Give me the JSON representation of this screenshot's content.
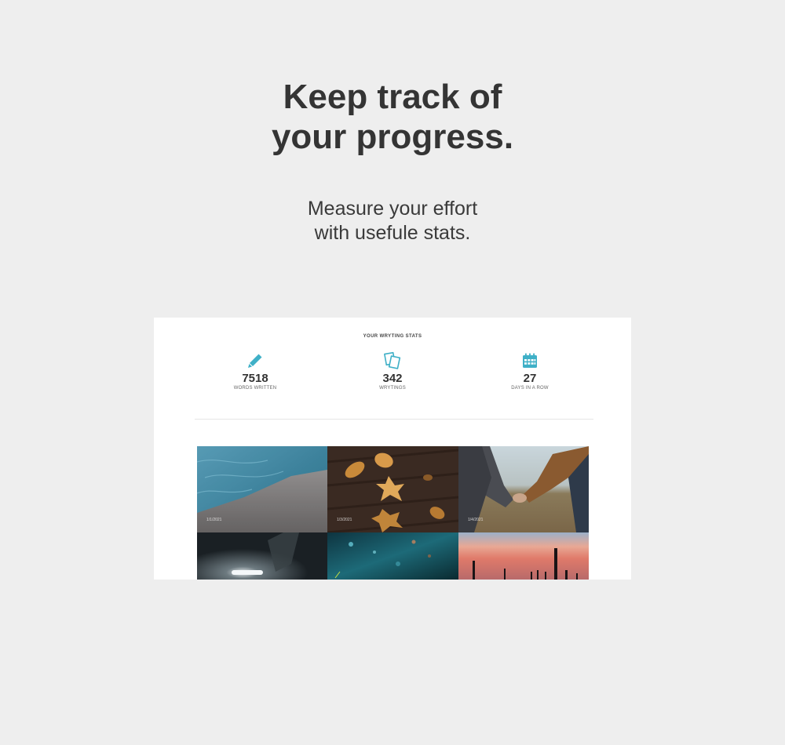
{
  "headline": {
    "line1": "Keep track of",
    "line2": "your progress."
  },
  "subhead": {
    "line1": "Measure your effort",
    "line2": "with usefule stats."
  },
  "stats": {
    "title": "YOUR WRYTING STATS",
    "accent": "#3fb0c7",
    "items": [
      {
        "icon": "pencil-icon",
        "value": "7518",
        "label": "WORDS WRITTEN"
      },
      {
        "icon": "papers-icon",
        "value": "342",
        "label": "WRYTINGS"
      },
      {
        "icon": "calendar-icon",
        "value": "27",
        "label": "DAYS IN A ROW"
      }
    ]
  },
  "gallery": {
    "tiles": [
      {
        "image": "pool-water-photo",
        "date": "1/1/2021"
      },
      {
        "image": "autumn-leaves-photo",
        "date": "1/3/2021"
      },
      {
        "image": "holding-hands-photo",
        "date": "1/4/2021"
      },
      {
        "image": "car-headlights-forest-photo",
        "date": ""
      },
      {
        "image": "rainy-neon-street-photo",
        "date": ""
      },
      {
        "image": "desert-sunset-cactus-photo",
        "date": ""
      }
    ]
  }
}
